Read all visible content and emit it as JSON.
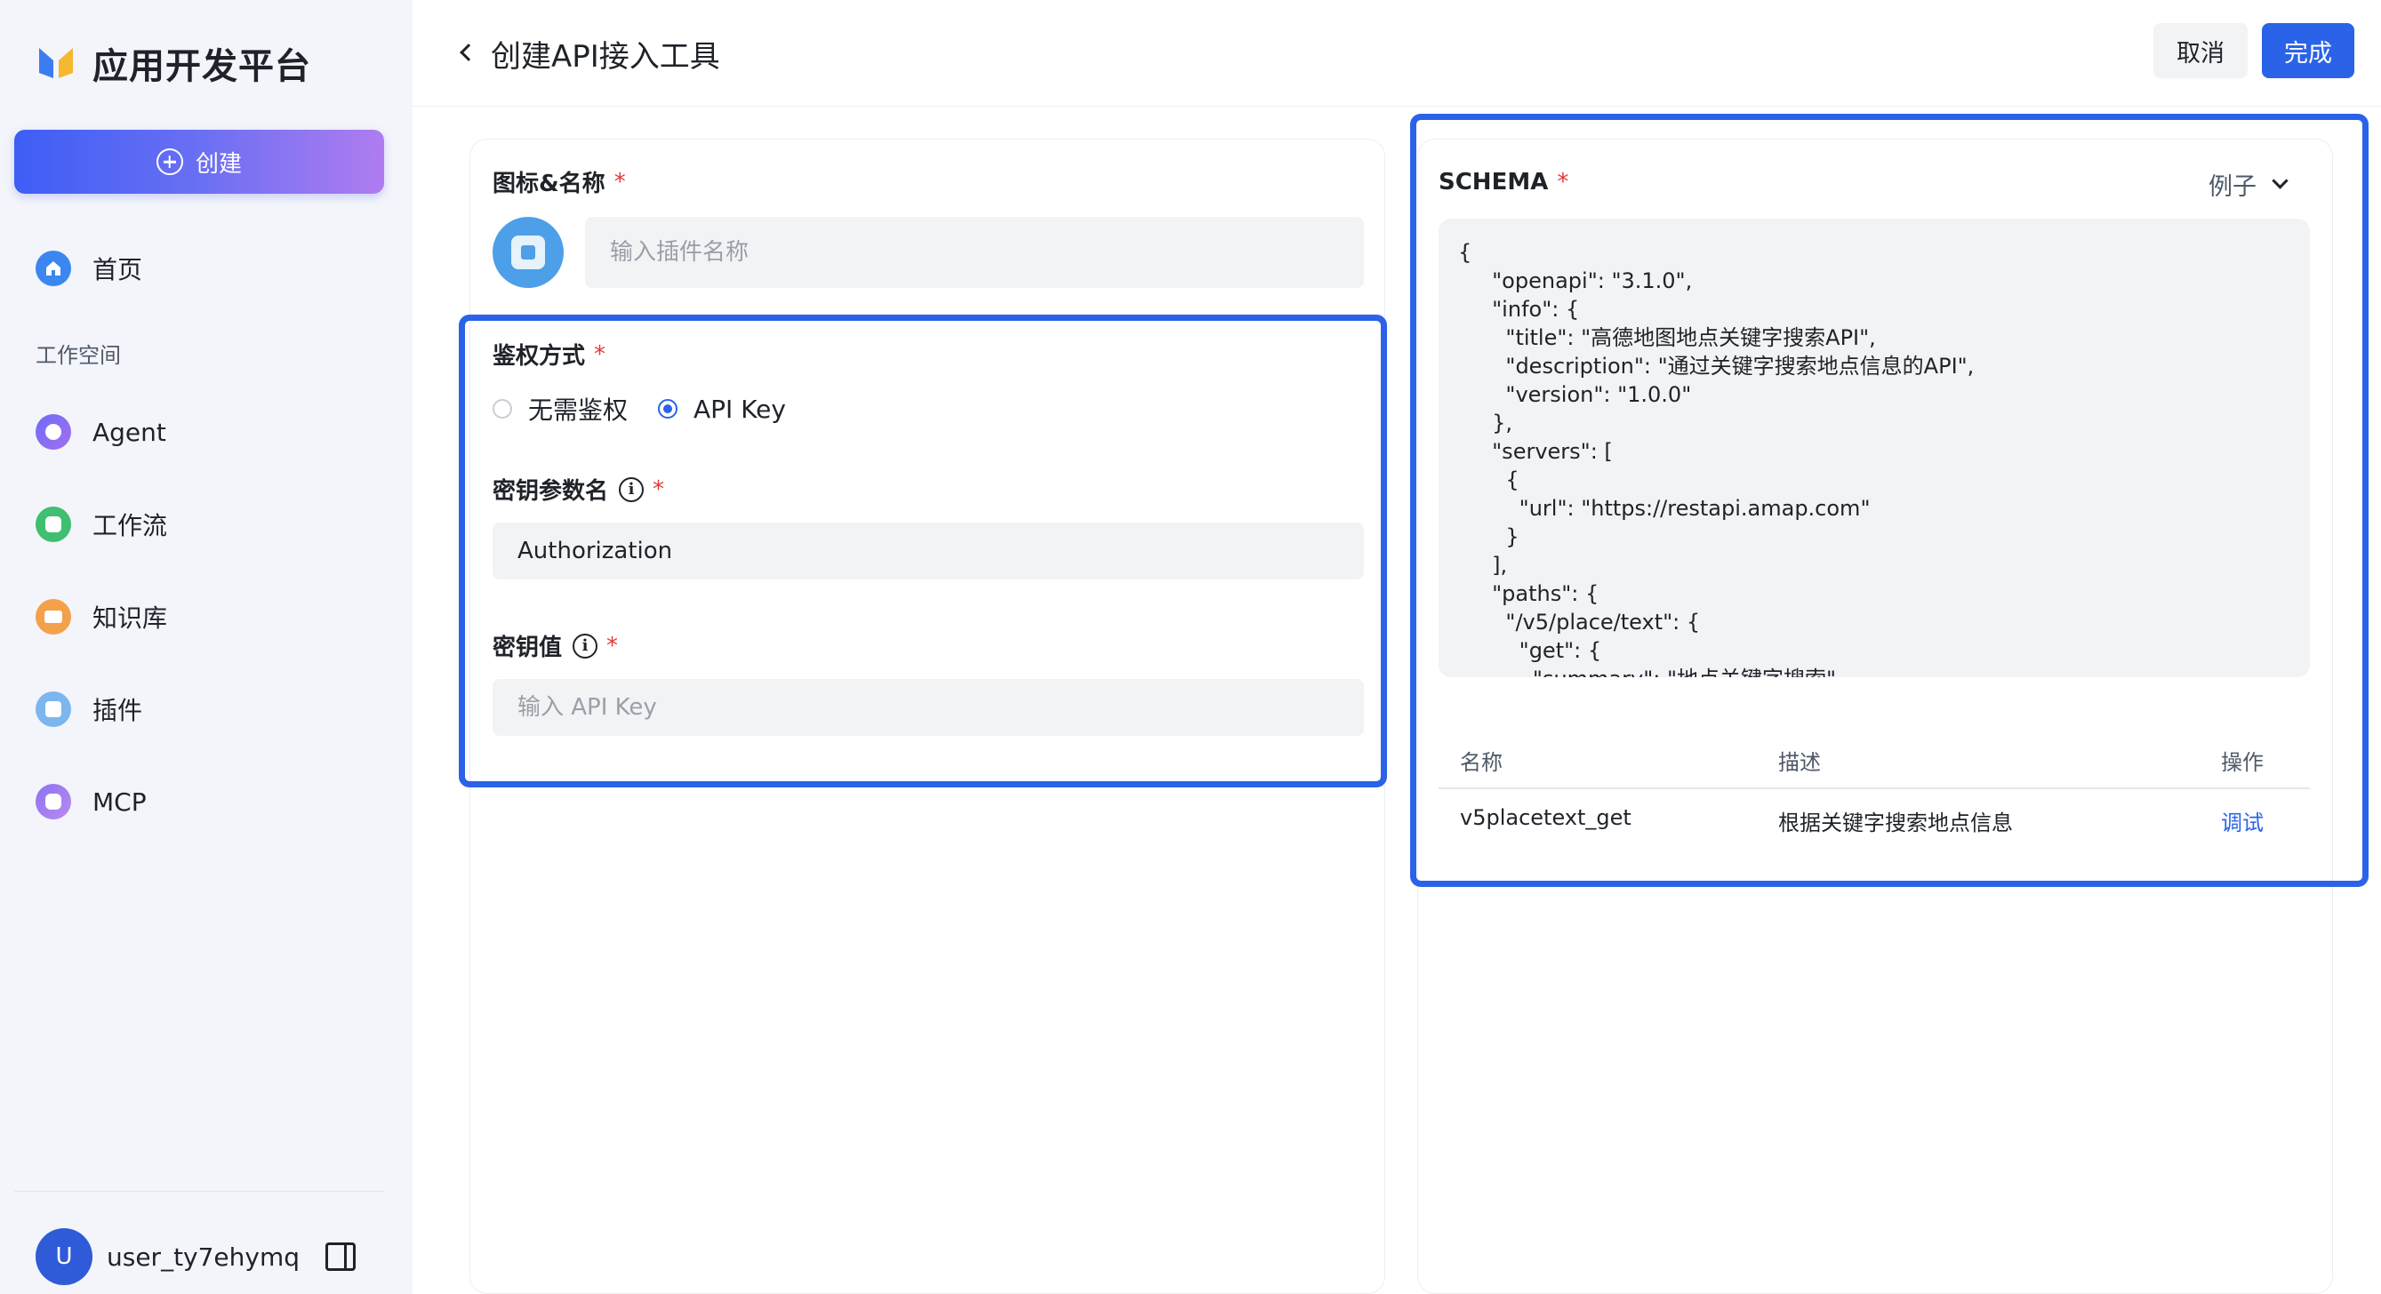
{
  "sidebar": {
    "brand": "应用开发平台",
    "create_label": "创建",
    "home": "首页",
    "section": "工作空间",
    "items": [
      {
        "label": "Agent"
      },
      {
        "label": "工作流"
      },
      {
        "label": "知识库"
      },
      {
        "label": "插件"
      },
      {
        "label": "MCP"
      }
    ],
    "user": {
      "avatar_letter": "U",
      "name": "user_ty7ehymq"
    }
  },
  "header": {
    "title": "创建API接入工具",
    "cancel": "取消",
    "done": "完成"
  },
  "form": {
    "icon_name_label": "图标&名称",
    "name_placeholder": "输入插件名称",
    "auth_label": "鉴权方式",
    "auth_options": [
      "无需鉴权",
      "API Key"
    ],
    "auth_selected": "API Key",
    "key_param_label": "密钥参数名",
    "key_param_value": "Authorization",
    "key_value_label": "密钥值",
    "key_value_placeholder": "输入 API Key",
    "required_mark": "*",
    "info_glyph": "i"
  },
  "schema": {
    "label": "SCHEMA",
    "example_label": "例子",
    "code": "{\n     \"openapi\": \"3.1.0\",\n     \"info\": {\n       \"title\": \"高德地图地点关键字搜索API\",\n       \"description\": \"通过关键字搜索地点信息的API\",\n       \"version\": \"1.0.0\"\n     },\n     \"servers\": [\n       {\n         \"url\": \"https://restapi.amap.com\"\n       }\n     ],\n     \"paths\": {\n       \"/v5/place/text\": {\n         \"get\": {\n           \"summary\": \"地点关键字搜索\",",
    "table": {
      "columns": [
        "名称",
        "描述",
        "操作"
      ],
      "rows": [
        {
          "name": "v5placetext_get",
          "desc": "根据关键字搜索地点信息",
          "action": "调试"
        }
      ]
    }
  },
  "colors": {
    "accent": "#2b63e8",
    "required": "#e03a3a",
    "sidebar_bg": "#f3f5fb"
  }
}
